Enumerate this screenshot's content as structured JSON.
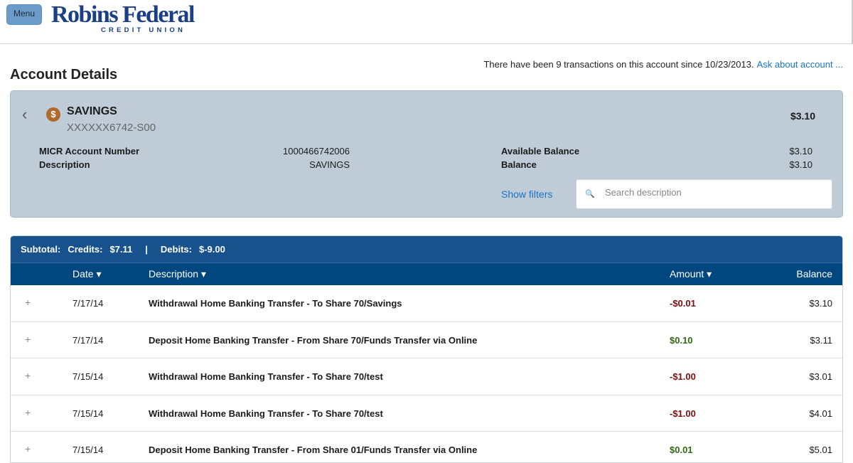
{
  "header": {
    "menu_label": "Menu",
    "logo_main": "Robins Federal",
    "logo_sub": "CREDIT UNION"
  },
  "page": {
    "title": "Account Details",
    "notice": "There have been 9 transactions on this account since 10/23/2013.",
    "ask_link": "Ask about account ..."
  },
  "account": {
    "name": "SAVINGS",
    "number": "XXXXXX6742-S00",
    "balance": "$3.10",
    "details": [
      {
        "label": "MICR Account Number",
        "value": "1000466742006"
      },
      {
        "label": "Description",
        "value": "SAVINGS"
      }
    ],
    "balances": [
      {
        "label": "Available Balance",
        "value": "$3.10"
      },
      {
        "label": "Balance",
        "value": "$3.10"
      }
    ],
    "show_filters": "Show filters",
    "search_placeholder": "Search description"
  },
  "subtotal": {
    "label": "Subtotal:",
    "credits_label": "Credits:",
    "credits": "$7.11",
    "sep": "|",
    "debits_label": "Debits:",
    "debits": "$-9.00"
  },
  "columns": {
    "date": "Date ▾",
    "description": "Description ▾",
    "amount": "Amount ▾",
    "balance": "Balance"
  },
  "transactions": [
    {
      "date": "7/17/14",
      "description": "Withdrawal Home Banking Transfer - To Share 70/Savings",
      "amount": "-$0.01",
      "balance": "$3.10"
    },
    {
      "date": "7/17/14",
      "description": "Deposit Home Banking Transfer - From Share 70/Funds Transfer via Online",
      "amount": "$0.10",
      "balance": "$3.11"
    },
    {
      "date": "7/15/14",
      "description": "Withdrawal Home Banking Transfer - To Share 70/test",
      "amount": "-$1.00",
      "balance": "$3.01"
    },
    {
      "date": "7/15/14",
      "description": "Withdrawal Home Banking Transfer - To Share 70/test",
      "amount": "-$1.00",
      "balance": "$4.01"
    },
    {
      "date": "7/15/14",
      "description": "Deposit Home Banking Transfer - From Share 01/Funds Transfer via Online",
      "amount": "$0.01",
      "balance": "$5.01"
    }
  ],
  "colors": {
    "header": "#00467f",
    "subtotal": "#17528c",
    "negative": "#7a0e0e",
    "positive": "#2e6b12",
    "link": "#1a73c9"
  }
}
